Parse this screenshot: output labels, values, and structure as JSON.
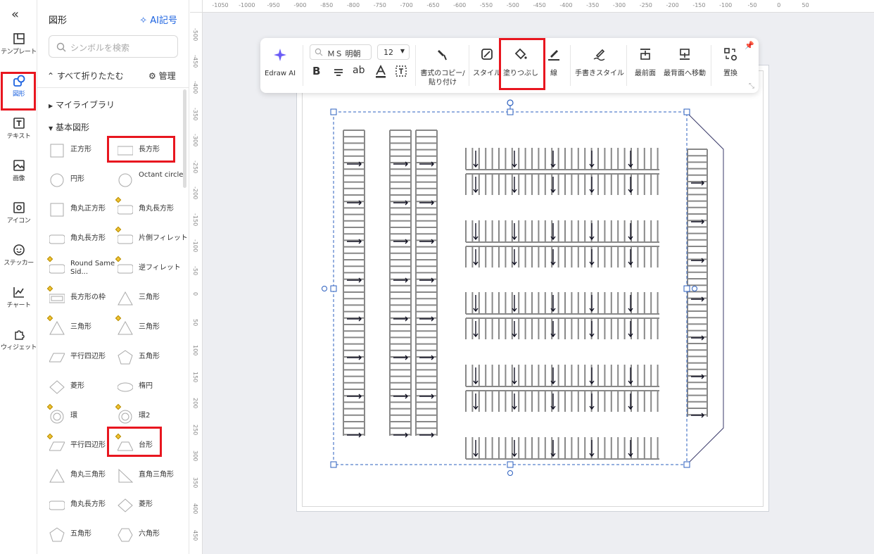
{
  "rail": {
    "items": [
      {
        "label": "テンプレート",
        "icon": "template-icon"
      },
      {
        "label": "図形",
        "icon": "shapes-icon",
        "active": true
      },
      {
        "label": "テキスト",
        "icon": "text-icon"
      },
      {
        "label": "画像",
        "icon": "image-icon"
      },
      {
        "label": "アイコン",
        "icon": "icon-library-icon"
      },
      {
        "label": "ステッカー",
        "icon": "sticker-icon"
      },
      {
        "label": "チャート",
        "icon": "chart-icon"
      },
      {
        "label": "ウィジェット",
        "icon": "widget-icon"
      }
    ]
  },
  "panel": {
    "title": "図形",
    "ai_label": "AI記号",
    "search_placeholder": "シンボルを検索",
    "collapse_all": "すべて折りたたむ",
    "manage": "管理",
    "sections": {
      "my_library": "マイライブラリ",
      "basic": "基本図形"
    },
    "shapes": [
      "正方形",
      "長方形",
      "円形",
      "Octant circle",
      "角丸正方形",
      "角丸長方形",
      "角丸長方形",
      "片側フィレット",
      "Round Same Sid...",
      "逆フィレット",
      "長方形の枠",
      "三角形",
      "三角形",
      "三角形",
      "平行四辺形",
      "五角形",
      "菱形",
      "楕円",
      "環",
      "環2",
      "平行四辺形",
      "台形",
      "角丸三角形",
      "直角三角形",
      "角丸長方形",
      "菱形",
      "五角形",
      "六角形"
    ]
  },
  "ruler": {
    "h": [
      "-1050",
      "-1000",
      "-950",
      "-900",
      "-850",
      "-800",
      "-750",
      "-700",
      "-650",
      "-600",
      "-550",
      "-500",
      "-450",
      "-400",
      "-350",
      "-300",
      "-250",
      "-200",
      "-150",
      "-100",
      "-50",
      "0",
      "50"
    ],
    "v": [
      "-500",
      "-450",
      "-400",
      "-350",
      "-300",
      "-250",
      "-200",
      "-150",
      "-100",
      "-50",
      "0",
      "50",
      "100",
      "150",
      "200",
      "250",
      "300",
      "350",
      "400",
      "450"
    ]
  },
  "toolbar": {
    "edraw_ai": "Edraw AI",
    "font": "ＭＳ 明朝",
    "size": "12",
    "format_copy": "書式のコピー/\n貼り付け",
    "style": "スタイル",
    "fill": "塗りつぶし",
    "line": "線",
    "hand_style": "手書きスタイル",
    "front": "最前面",
    "back": "最背面へ移動",
    "replace": "置換"
  }
}
